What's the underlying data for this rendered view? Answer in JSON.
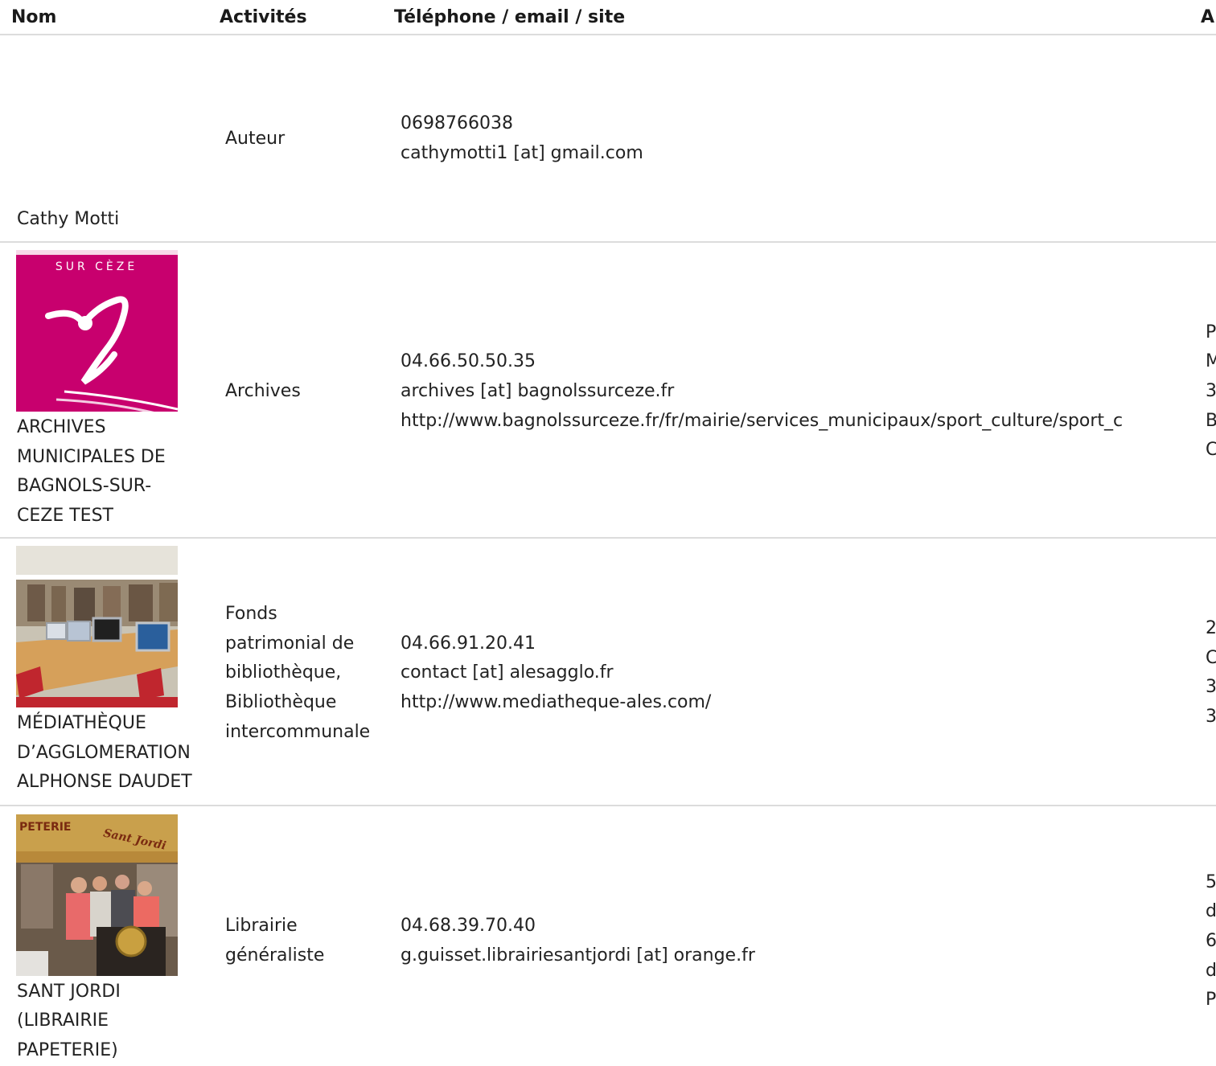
{
  "headers": {
    "nom": "Nom",
    "activites": "Activités",
    "contact": "Téléphone / email / site",
    "adresse": "A"
  },
  "rows": [
    {
      "name_lines": [
        "Cathy Motti"
      ],
      "activity_lines": [
        "Auteur"
      ],
      "phone": "0698766038",
      "email": "cathymotti1 [at] gmail.com",
      "site": "",
      "address_lines": []
    },
    {
      "image_text": {
        "top": "SUR CÈZE"
      },
      "name_lines": [
        "ARCHIVES",
        "MUNICIPALES DE",
        "BAGNOLS-SUR-",
        "CEZE TEST"
      ],
      "activity_lines": [
        "Archives"
      ],
      "phone": "04.66.50.50.35",
      "email": "archives [at] bagnolssurceze.fr",
      "site": "http://www.bagnolssurceze.fr/fr/mairie/services_municipaux/sport_culture/sport_c",
      "address_lines": [
        "P",
        "M",
        "3",
        "B",
        "C"
      ]
    },
    {
      "name_lines": [
        "MÉDIATHÈQUE",
        "D’AGGLOMERATION",
        "ALPHONSE DAUDET"
      ],
      "activity_lines": [
        "Fonds",
        "patrimonial de",
        "bibliothèque,",
        "Bibliothèque",
        "intercommunale"
      ],
      "phone": "04.66.91.20.41",
      "email": "contact [at] alesagglo.fr",
      "site": "http://www.mediatheque-ales.com/",
      "address_lines": [
        "2",
        "C",
        "3",
        "3"
      ]
    },
    {
      "image_text": {
        "sign": "PETERIE",
        "shop": "Sant Jordi"
      },
      "name_lines": [
        "SANT JORDI",
        "(LIBRAIRIE",
        "PAPETERIE)"
      ],
      "activity_lines": [
        "Librairie",
        "généraliste"
      ],
      "phone": "04.68.39.70.40",
      "email": "g.guisset.librairiesantjordi [at] orange.fr",
      "site": "",
      "address_lines": [
        "5",
        "d",
        "6",
        "d",
        "P"
      ]
    }
  ],
  "colors": {
    "archives_logo_bg": "#c8006e",
    "divider": "#dcdcdc",
    "text": "#222222"
  }
}
